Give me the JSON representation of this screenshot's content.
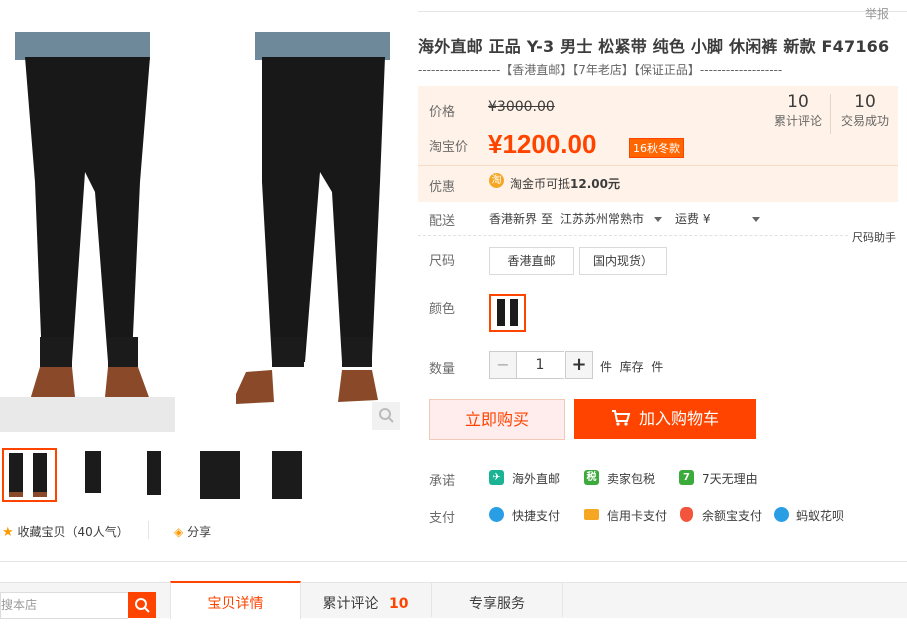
{
  "header": {
    "report": "举报"
  },
  "product": {
    "title": "海外直邮 正品 Y-3 男士 松紧带 纯色 小脚 休闲裤 新款 F47166",
    "subtitle": "-------------------【香港直邮】【7年老店】【保证正品】-------------------"
  },
  "price": {
    "label_price": "价格",
    "original": "¥3000.00",
    "label_taobao": "淘宝价",
    "current": "¥1200.00",
    "badge": "16秋冬款",
    "reviews_count": "10",
    "reviews_label": "累计评论",
    "sales_count": "10",
    "sales_label": "交易成功",
    "promo_label": "优惠",
    "promo_coin_icon": "淘",
    "promo_text": "淘金币可抵",
    "promo_amount": "12.00元"
  },
  "shipping": {
    "label": "配送",
    "from": "香港新界",
    "to_word": "至",
    "to": "江苏苏州常熟市",
    "fee": "运费 ¥",
    "size_helper": "尺码助手"
  },
  "sku": {
    "size_label": "尺码",
    "sizes": [
      "香港直邮",
      "国内现货）"
    ],
    "color_label": "颜色",
    "qty_label": "数量",
    "qty_value": "1",
    "minus": "−",
    "plus": "+",
    "stock_text": "件  库存  件"
  },
  "actions": {
    "buy_now": "立即购买",
    "add_to_cart": "加入购物车"
  },
  "promise": {
    "label": "承诺",
    "items": [
      "海外直邮",
      "卖家包税",
      "7天无理由"
    ],
    "icons": [
      "✈",
      "税",
      "7"
    ]
  },
  "payment": {
    "label": "支付",
    "items": [
      "快捷支付",
      "信用卡支付",
      "余额宝支付",
      "蚂蚁花呗"
    ]
  },
  "gallery": {
    "favorite": "收藏宝贝（40人气）",
    "share": "分享",
    "zoom_icon": "search-icon"
  },
  "tabs": {
    "search_placeholder": "搜本店",
    "items": [
      {
        "label": "宝贝详情"
      },
      {
        "label": "累计评论",
        "count": "10"
      },
      {
        "label": "专享服务"
      }
    ]
  },
  "colors": {
    "accent": "#ff4400",
    "price_bg": "#fff2e8",
    "buy_bg": "#ffeded"
  }
}
